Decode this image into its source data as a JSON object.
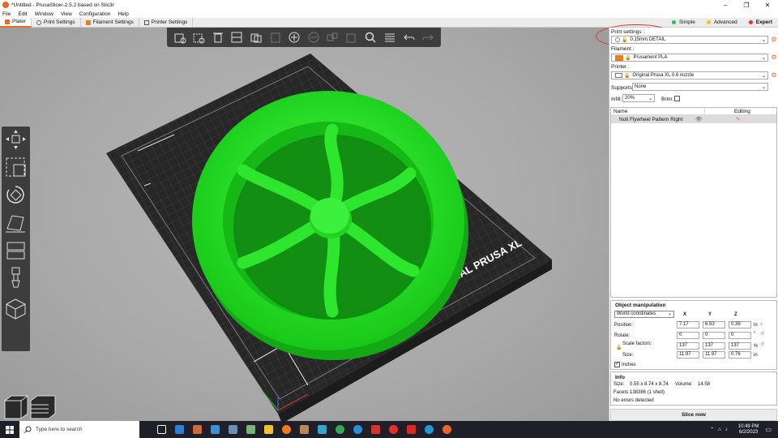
{
  "window": {
    "title": "*Untitled - PrusaSlicer-2.5.2 based on Slic3r",
    "minimize": "–",
    "maximize": "❐",
    "close": "✕"
  },
  "menu": [
    "File",
    "Edit",
    "Window",
    "View",
    "Configuration",
    "Help"
  ],
  "tabs": [
    {
      "label": "Plater",
      "icon": "plater-icon",
      "active": true
    },
    {
      "label": "Print Settings",
      "icon": "gear-icon",
      "active": false
    },
    {
      "label": "Filament Settings",
      "icon": "filament-icon",
      "active": false
    },
    {
      "label": "Printer Settings",
      "icon": "printer-icon",
      "active": false
    }
  ],
  "modes": [
    {
      "label": "Simple",
      "color": "#27c43b",
      "active": false
    },
    {
      "label": "Advanced",
      "color": "#f5c518",
      "active": false
    },
    {
      "label": "Expert",
      "color": "#e4322b",
      "active": true
    }
  ],
  "viewport": {
    "bed_label": "ORIGINAL PRUSA XL",
    "model_color": "#22ee22",
    "bed_color": "#2e2e2e"
  },
  "panel": {
    "print_settings_label": "Print settings :",
    "print_settings_value": "0.15mm DETAIL",
    "filament_label": "Filament :",
    "filament_value": "Prusament PLA",
    "filament_color": "#e8801a",
    "printer_label": "Printer :",
    "printer_value": "Original Prusa XL 0.6 nozzle",
    "supports_label": "Supports:",
    "supports_value": "None",
    "infill_label": "Infill:",
    "infill_value": "20%",
    "brim_label": "Brim:"
  },
  "object_list": {
    "col_name": "Name",
    "col_editing": "Editing",
    "rows": [
      {
        "name": "Noli Flywheel Pattern Right"
      }
    ]
  },
  "object_manipulation": {
    "title": "Object manipulation",
    "coord_system": "World coordinates",
    "axes": [
      "X",
      "Y",
      "Z"
    ],
    "position_label": "Position:",
    "position": [
      "7.17",
      "6.93",
      "0.38"
    ],
    "position_unit": "in",
    "rotate_label": "Rotate:",
    "rotate": [
      "0",
      "0",
      "0"
    ],
    "rotate_unit": "°",
    "scale_label": "Scale factors:",
    "scale": [
      "137",
      "137",
      "137"
    ],
    "scale_unit": "%",
    "size_label": "Size:",
    "size": [
      "11.97",
      "11.97",
      "0.76"
    ],
    "size_unit": "in",
    "inches_label": "Inches"
  },
  "info": {
    "title": "Info",
    "size_label": "Size:",
    "size_value": "0.55 x 8.74 x 8.74",
    "volume_label": "Volume:",
    "volume_value": "14.58",
    "facets_label": "Facets:",
    "facets_value": "138386 (1 shell)",
    "errors": "No errors detected"
  },
  "slice_button": "Slice now",
  "taskbar": {
    "search_placeholder": "Type here to search",
    "time": "10:49 PM",
    "date": "6/2/2023",
    "apps": [
      {
        "name": "task-view-icon",
        "color": "#ffffff"
      },
      {
        "name": "mail-icon",
        "color": "#2f7fd6"
      },
      {
        "name": "media-icon",
        "color": "#c96a3a"
      },
      {
        "name": "network-icon",
        "color": "#3c8fd1"
      },
      {
        "name": "calculator-icon",
        "color": "#6a8fb0"
      },
      {
        "name": "notepad-icon",
        "color": "#7bb27b"
      },
      {
        "name": "file-explorer-icon",
        "color": "#f1c232"
      },
      {
        "name": "firefox-icon",
        "color": "#f07a1a"
      },
      {
        "name": "gimp-icon",
        "color": "#b58a5a"
      },
      {
        "name": "app-icon",
        "color": "#36a3c7"
      },
      {
        "name": "xbox-icon",
        "color": "#3aa655"
      },
      {
        "name": "vpn-icon",
        "color": "#2a8fd4"
      },
      {
        "name": "photo-icon",
        "color": "#d0372c"
      },
      {
        "name": "office-icon",
        "color": "#e4322b"
      },
      {
        "name": "acrobat-icon",
        "color": "#d72b20"
      },
      {
        "name": "edge-icon",
        "color": "#2795d3"
      },
      {
        "name": "prusaslicer-icon",
        "color": "#e8662a"
      }
    ]
  }
}
